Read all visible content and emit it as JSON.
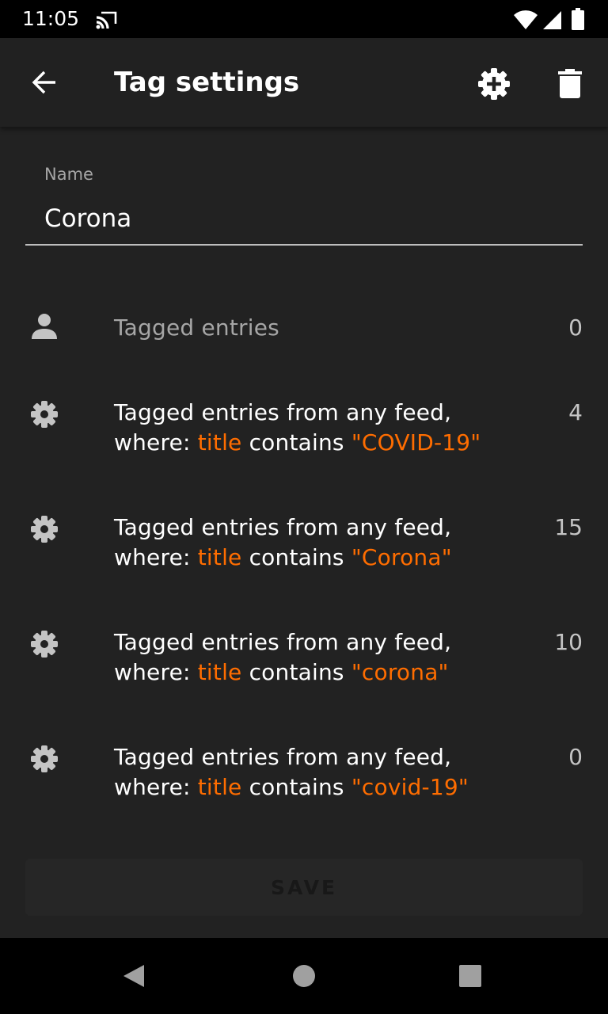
{
  "status_bar": {
    "time": "11:05",
    "icons": [
      "cast-icon",
      "wifi-icon",
      "signal-icon",
      "battery-icon"
    ]
  },
  "app_bar": {
    "title": "Tag settings",
    "back_icon": "arrow-back-icon",
    "add_icon": "gear-plus-icon",
    "delete_icon": "trash-icon"
  },
  "name_field": {
    "label": "Name",
    "value": "Corona"
  },
  "tagged_entries": {
    "label": "Tagged entries",
    "count": "0",
    "icon": "person-icon"
  },
  "rules": [
    {
      "line1": "Tagged entries from any feed,",
      "prefix": "where: ",
      "field": "title",
      "op": " contains ",
      "term": "\"COVID-19\"",
      "count": "4"
    },
    {
      "line1": "Tagged entries from any feed,",
      "prefix": "where: ",
      "field": "title",
      "op": " contains ",
      "term": "\"Corona\"",
      "count": "15"
    },
    {
      "line1": "Tagged entries from any feed,",
      "prefix": "where: ",
      "field": "title",
      "op": " contains ",
      "term": "\"corona\"",
      "count": "10"
    },
    {
      "line1": "Tagged entries from any feed,",
      "prefix": "where: ",
      "field": "title",
      "op": " contains ",
      "term": "\"covid-19\"",
      "count": "0"
    }
  ],
  "save_button": {
    "label": "SAVE",
    "enabled": false
  },
  "colors": {
    "background": "#222222",
    "highlight": "#ff6d00",
    "status_bar": "#000000"
  }
}
